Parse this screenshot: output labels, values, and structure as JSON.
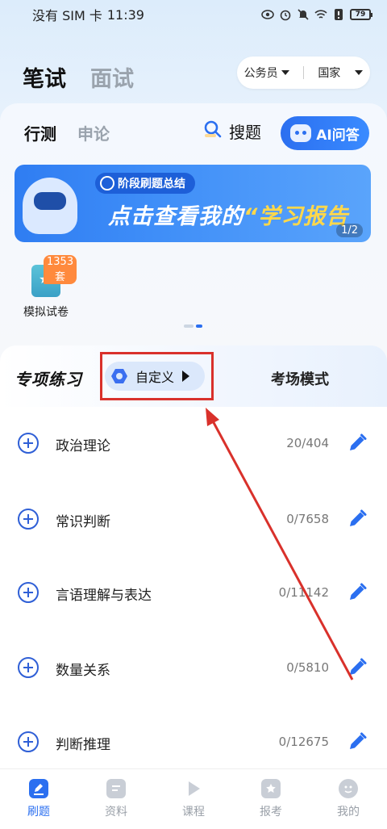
{
  "status_bar": {
    "left_text": "没有 SIM 卡",
    "time": "11:39",
    "battery": "79"
  },
  "main_tabs": [
    {
      "label": "笔试",
      "active": true
    },
    {
      "label": "面试",
      "active": false
    }
  ],
  "exam_selector": {
    "category": "公务员",
    "region": "国家"
  },
  "sub_tabs": [
    {
      "label": "行测",
      "active": true
    },
    {
      "label": "申论",
      "active": false
    }
  ],
  "search": {
    "label": "搜题"
  },
  "ai": {
    "label": "AI问答"
  },
  "banner": {
    "tag": "阶段刷题总结",
    "headline_prefix": "点击查看我的",
    "headline_highlight": "“学习报告",
    "page": "1/2"
  },
  "mock_paper": {
    "badge": "1353套",
    "label": "模拟试卷"
  },
  "practice": {
    "title": "专项练习",
    "custom_label": "自定义",
    "exam_mode": "考场模式"
  },
  "list": [
    {
      "name": "政治理论",
      "count": "20/404"
    },
    {
      "name": "常识判断",
      "count": "0/7658"
    },
    {
      "name": "言语理解与表达",
      "count": "0/11142"
    },
    {
      "name": "数量关系",
      "count": "0/5810"
    },
    {
      "name": "判断推理",
      "count": "0/12675"
    }
  ],
  "bottom_nav": [
    {
      "label": "刷题",
      "icon": "edit-icon",
      "active": true
    },
    {
      "label": "资料",
      "icon": "document-icon",
      "active": false
    },
    {
      "label": "课程",
      "icon": "play-icon",
      "active": false
    },
    {
      "label": "报考",
      "icon": "bookmark-icon",
      "active": false
    },
    {
      "label": "我的",
      "icon": "profile-icon",
      "active": false
    }
  ],
  "colors": {
    "accent": "#2b6ff0",
    "annotation": "#d9312b"
  }
}
